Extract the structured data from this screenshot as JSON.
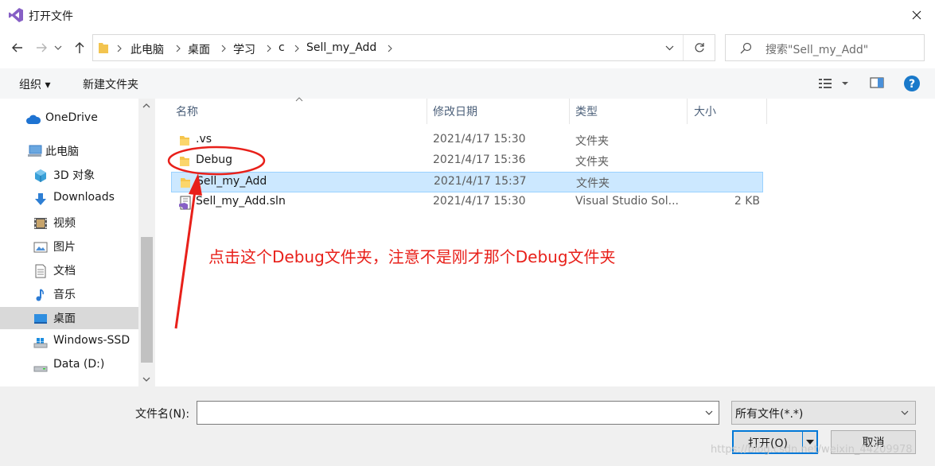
{
  "window": {
    "title": "打开文件"
  },
  "nav_buttons": {
    "back": "back-arrow",
    "forward": "forward-arrow",
    "up": "up-arrow"
  },
  "breadcrumb": [
    "此电脑",
    "桌面",
    "学习",
    "c",
    "Sell_my_Add"
  ],
  "search": {
    "placeholder": "搜索\"Sell_my_Add\""
  },
  "toolbar": {
    "organize": "组织 ▾",
    "new_folder": "新建文件夹"
  },
  "sidebar": {
    "items": [
      {
        "label": "OneDrive",
        "icon": "cloud-icon"
      },
      {
        "label": "此电脑",
        "icon": "computer-icon"
      },
      {
        "label": "3D 对象",
        "icon": "3d-objects-icon"
      },
      {
        "label": "Downloads",
        "icon": "download-icon"
      },
      {
        "label": "视频",
        "icon": "video-icon"
      },
      {
        "label": "图片",
        "icon": "pictures-icon"
      },
      {
        "label": "文档",
        "icon": "documents-icon"
      },
      {
        "label": "音乐",
        "icon": "music-icon"
      },
      {
        "label": "桌面",
        "icon": "desktop-icon",
        "selected": true
      },
      {
        "label": "Windows-SSD",
        "icon": "drive-icon"
      },
      {
        "label": "Data (D:)",
        "icon": "drive-icon"
      }
    ]
  },
  "columns": {
    "name": "名称",
    "modified": "修改日期",
    "type": "类型",
    "size": "大小"
  },
  "files": [
    {
      "name": ".vs",
      "modified": "2021/4/17 15:30",
      "type": "文件夹",
      "size": "",
      "icon": "folder-icon"
    },
    {
      "name": "Debug",
      "modified": "2021/4/17 15:36",
      "type": "文件夹",
      "size": "",
      "icon": "folder-icon"
    },
    {
      "name": "Sell_my_Add",
      "modified": "2021/4/17 15:37",
      "type": "文件夹",
      "size": "",
      "icon": "folder-icon",
      "selected": true
    },
    {
      "name": "Sell_my_Add.sln",
      "modified": "2021/4/17 15:30",
      "type": "Visual Studio Sol...",
      "size": "2 KB",
      "icon": "vs-solution-icon"
    }
  ],
  "annotation": "点击这个Debug文件夹，注意不是刚才那个Debug文件夹",
  "bottom": {
    "filename_label": "文件名(N):",
    "filename_value": "",
    "filter": "所有文件(*.*)",
    "open": "打开(O)",
    "cancel": "取消"
  },
  "watermark": "https://blog.csdn.net/weixin_44209978",
  "colors": {
    "accent": "#0078d7",
    "selection": "#cce8ff",
    "annotation": "#e8201a"
  }
}
